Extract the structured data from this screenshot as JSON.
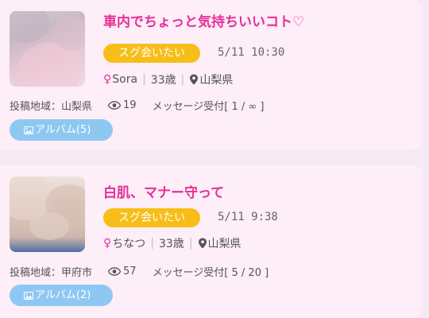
{
  "posts": [
    {
      "title": "車内でちょっと気持ちいいコト♡",
      "badge": "スグ会いたい",
      "datetime": "5/11 10:30",
      "sex_symbol": "♀",
      "name": "Sora",
      "age": "33歳",
      "location": "山梨県",
      "area_label": "投稿地域：山梨県",
      "views": "19",
      "inbox_label": "メッセージ受付[ 1 / ∞ ]",
      "album_label": "アルバム(5)"
    },
    {
      "title": "白肌、マナー守って",
      "badge": "スグ会いたい",
      "datetime": "5/11 9:38",
      "sex_symbol": "♀",
      "name": "ちなつ",
      "age": "33歳",
      "location": "山梨県",
      "area_label": "投稿地域：甲府市",
      "views": "57",
      "inbox_label": "メッセージ受付[ 5 / 20 ]",
      "album_label": "アルバム(2)"
    }
  ],
  "colors": {
    "title": "#e62e9a",
    "badge": "#f7be1a",
    "album_button": "#8ec8f2",
    "card_background": "#fdeef7",
    "page_background": "#f7e9f3"
  },
  "icons": {
    "pin": "map-pin-icon",
    "views": "eye-icon",
    "album": "image-icon"
  }
}
